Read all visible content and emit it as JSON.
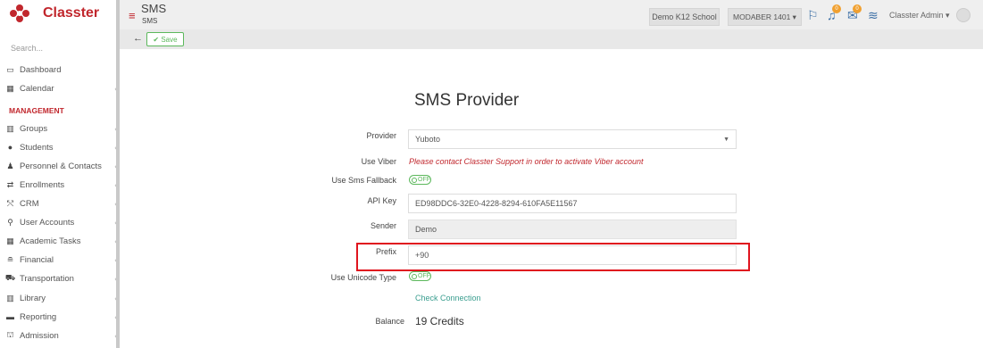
{
  "app": {
    "name": "Classter"
  },
  "sidebar": {
    "search_placeholder": "Search...",
    "items": [
      {
        "label": "Dashboard",
        "icon": "monitor-icon"
      },
      {
        "label": "Calendar",
        "icon": "calendar-icon"
      }
    ],
    "section_label": "MANAGEMENT",
    "management_items": [
      {
        "label": "Groups",
        "icon": "groups-icon"
      },
      {
        "label": "Students",
        "icon": "students-icon"
      },
      {
        "label": "Personnel & Contacts",
        "icon": "personnel-icon"
      },
      {
        "label": "Enrollments",
        "icon": "enrollments-icon"
      },
      {
        "label": "CRM",
        "icon": "crm-icon"
      },
      {
        "label": "User Accounts",
        "icon": "user-accounts-icon"
      },
      {
        "label": "Academic Tasks",
        "icon": "academic-tasks-icon"
      },
      {
        "label": "Financial",
        "icon": "financial-icon"
      },
      {
        "label": "Transportation",
        "icon": "bus-icon"
      },
      {
        "label": "Library",
        "icon": "library-icon"
      },
      {
        "label": "Reporting",
        "icon": "printer-icon"
      },
      {
        "label": "Admission",
        "icon": "admission-icon"
      }
    ]
  },
  "header": {
    "title": "SMS",
    "subtitle": "SMS",
    "school": "Demo K12 School",
    "year": "MODABER 1401",
    "notif_count_1": "0",
    "notif_count_2": "0",
    "user": "Classter Admin"
  },
  "toolbar": {
    "save_label": "Save"
  },
  "form": {
    "title": "SMS Provider",
    "provider_label": "Provider",
    "provider_value": "Yuboto",
    "viber_label": "Use Viber",
    "viber_message": "Please contact Classter Support in order to activate Viber account",
    "fallback_label": "Use Sms Fallback",
    "fallback_toggle": "OFF",
    "apikey_label": "API Key",
    "apikey_value": "ED98DDC6-32E0-4228-8294-610FA5E11567",
    "sender_label": "Sender",
    "sender_value": "Demo",
    "prefix_label": "Prefix",
    "prefix_value": "+90",
    "unicode_label": "Use Unicode Type",
    "unicode_toggle": "OFF",
    "check_connection": "Check Connection",
    "balance_label": "Balance",
    "balance_value": "19 Credits"
  },
  "colors": {
    "brand": "#c1272d",
    "highlight": "#e0141e",
    "success": "#5cb85c"
  }
}
